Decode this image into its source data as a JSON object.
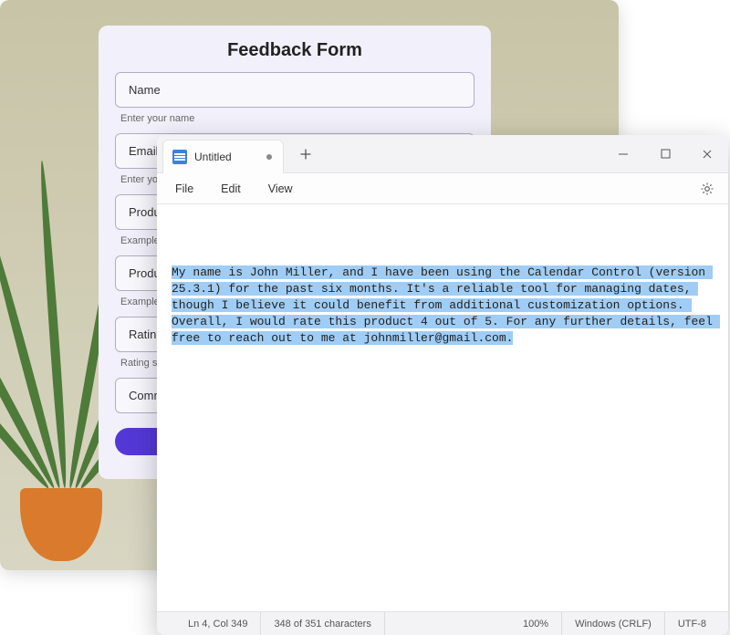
{
  "form": {
    "title": "Feedback Form",
    "fields": [
      {
        "label": "Name",
        "hint": "Enter your name"
      },
      {
        "label": "Email",
        "hint": "Enter you"
      },
      {
        "label": "Product I",
        "hint": "Example"
      },
      {
        "label": "Product \\",
        "hint": "Example"
      },
      {
        "label": "Rating",
        "hint": "Rating sh"
      },
      {
        "label": "Commen",
        "hint": ""
      }
    ]
  },
  "notepad": {
    "tab_title": "Untitled",
    "menus": {
      "file": "File",
      "edit": "Edit",
      "view": "View"
    },
    "text": "My name is John Miller, and I have been using the Calendar Control (version 25.3.1) for the past six months. It's a reliable tool for managing dates, though I believe it could benefit from additional customization options. Overall, I would rate this product 4 out of 5. For any further details, feel free to reach out to me at johnmiller@gmail.com.",
    "status": {
      "caret": "Ln 4, Col 349",
      "selection": "348 of 351 characters",
      "zoom": "100%",
      "eol": "Windows (CRLF)",
      "encoding": "UTF-8"
    }
  }
}
